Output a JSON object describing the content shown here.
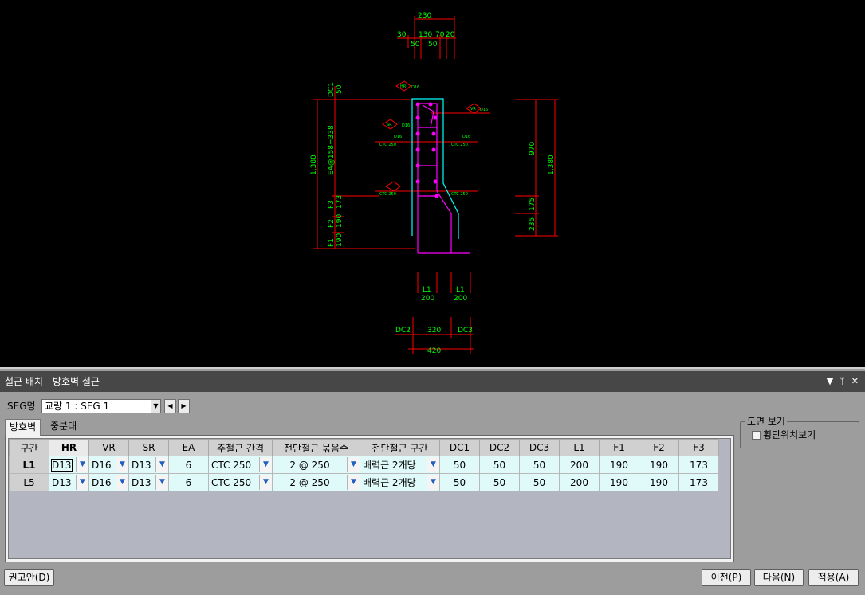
{
  "drawing": {
    "dims_green": [
      "230",
      "30",
      "130",
      "70",
      "20",
      "50",
      "50",
      "DC1",
      "50",
      "EA@158=338",
      "F3",
      "173",
      "F2",
      "190",
      "F1",
      "190",
      "1,380",
      "970",
      "1,380",
      "175",
      "235",
      "L1",
      "200",
      "L1",
      "200",
      "DC2",
      "320",
      "DC3",
      "420"
    ],
    "bar_tags": [
      "HR",
      "D16",
      "VR",
      "D16",
      "D16",
      "SR",
      "D16",
      "D16",
      "CTC 250",
      "CTC 250",
      "CTC 250",
      "CTC 250"
    ]
  },
  "panel": {
    "title": "철근 배치 - 방호벽 철근",
    "ctrl_menu": "▼",
    "ctrl_pin": "ᛘ",
    "ctrl_close": "✕",
    "seg_label": "SEG명",
    "seg_value": "교량 1 : SEG 1",
    "tabs": [
      "방호벽",
      "중분대"
    ],
    "columns": [
      "구간",
      "HR",
      "VR",
      "SR",
      "EA",
      "주철근 간격",
      "전단철근 묶음수",
      "전단철근 구간",
      "DC1",
      "DC2",
      "DC3",
      "L1",
      "F1",
      "F2",
      "F3"
    ],
    "rows": [
      {
        "name": "L1",
        "HR": "D13",
        "VR": "D16",
        "SR": "D13",
        "EA": "6",
        "spacing": "CTC 250",
        "bundle": "2 @ 250",
        "section": "배력근 2개당",
        "DC1": "50",
        "DC2": "50",
        "DC3": "50",
        "L1": "200",
        "F1": "190",
        "F2": "190",
        "F3": "173"
      },
      {
        "name": "L5",
        "HR": "D13",
        "VR": "D16",
        "SR": "D13",
        "EA": "6",
        "spacing": "CTC 250",
        "bundle": "2 @ 250",
        "section": "배력근 2개당",
        "DC1": "50",
        "DC2": "50",
        "DC3": "50",
        "L1": "200",
        "F1": "190",
        "F2": "190",
        "F3": "173"
      }
    ],
    "view_group_title": "도면 보기",
    "view_checkbox_label": "횡단위치보기",
    "btn_recommend": "권고안(D)",
    "btn_prev": "이전(P)",
    "btn_next": "다음(N)",
    "btn_apply": "적용(A)"
  },
  "colors": {
    "canvas_bg": "#000000",
    "dim_line": "#ff0000",
    "dim_text": "#00ff00",
    "rebar": "#ff00ff",
    "outline": "#00ffff",
    "panel_bg": "#9d9d9d",
    "grid_cell": "#e0fafa"
  }
}
